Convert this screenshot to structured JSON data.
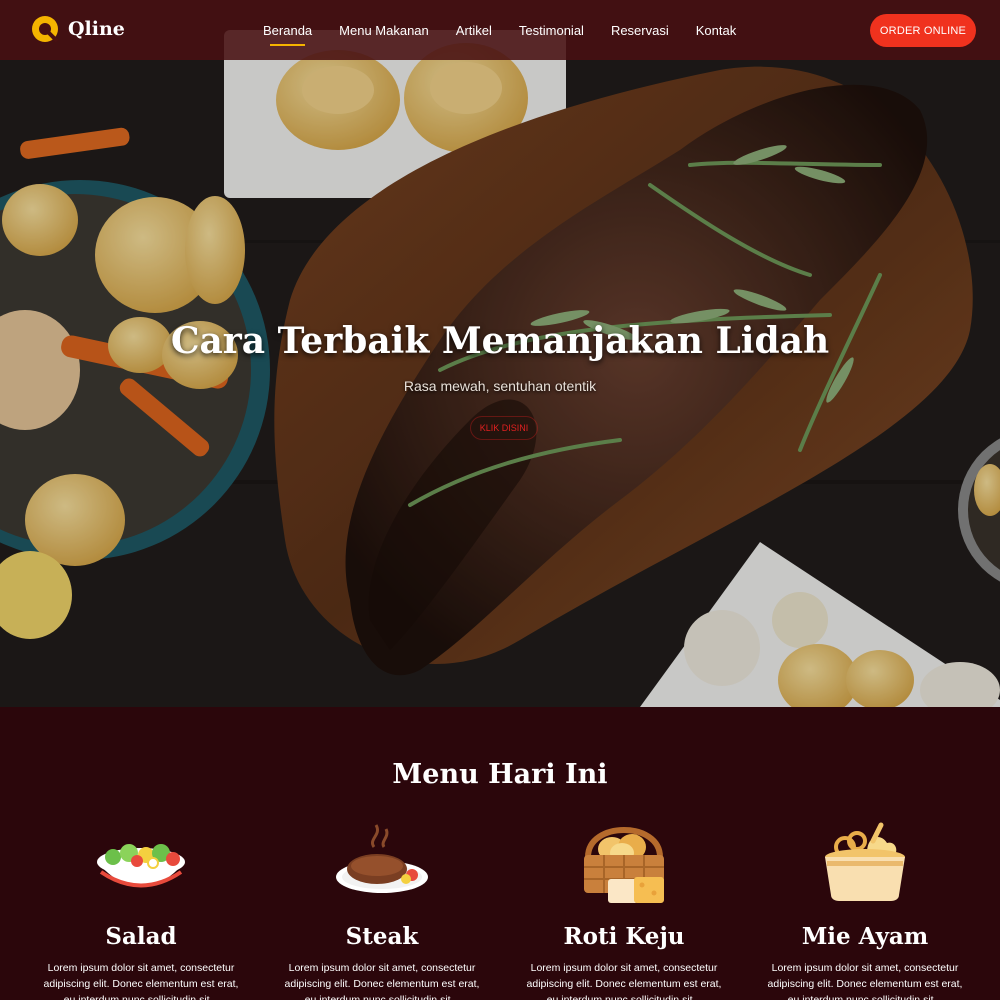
{
  "brand": {
    "name": "Qline",
    "logo_icon": "q-logo-icon",
    "accent": "#f5b400"
  },
  "nav": {
    "items": [
      {
        "label": "Beranda",
        "active": true
      },
      {
        "label": "Menu Makanan"
      },
      {
        "label": "Artikel"
      },
      {
        "label": "Testimonial"
      },
      {
        "label": "Reservasi"
      },
      {
        "label": "Kontak"
      }
    ],
    "order_button": "ORDER ONLINE",
    "order_color": "#f0321e"
  },
  "hero": {
    "title": "Cara Terbaik Memanjakan Lidah",
    "subtitle": "Rasa mewah, sentuhan otentik",
    "cta": "KLIK DISINI"
  },
  "menu": {
    "title": "Menu Hari Ini",
    "items": [
      {
        "name": "Salad",
        "icon": "salad-bowl-icon",
        "desc": "Lorem ipsum dolor sit amet, consectetur adipiscing elit. Donec elementum est erat, eu interdum nunc sollicitudin sit..."
      },
      {
        "name": "Steak",
        "icon": "steak-plate-icon",
        "desc": "Lorem ipsum dolor sit amet, consectetur adipiscing elit. Donec elementum est erat, eu interdum nunc sollicitudin sit..."
      },
      {
        "name": "Roti Keju",
        "icon": "bread-basket-icon",
        "desc": "Lorem ipsum dolor sit amet, consectetur adipiscing elit. Donec elementum est erat, eu interdum nunc sollicitudin sit..."
      },
      {
        "name": "Mie Ayam",
        "icon": "noodle-bowl-icon",
        "desc": "Lorem ipsum dolor sit amet, consectetur adipiscing elit. Donec elementum est erat, eu interdum nunc sollicitudin sit..."
      }
    ]
  }
}
